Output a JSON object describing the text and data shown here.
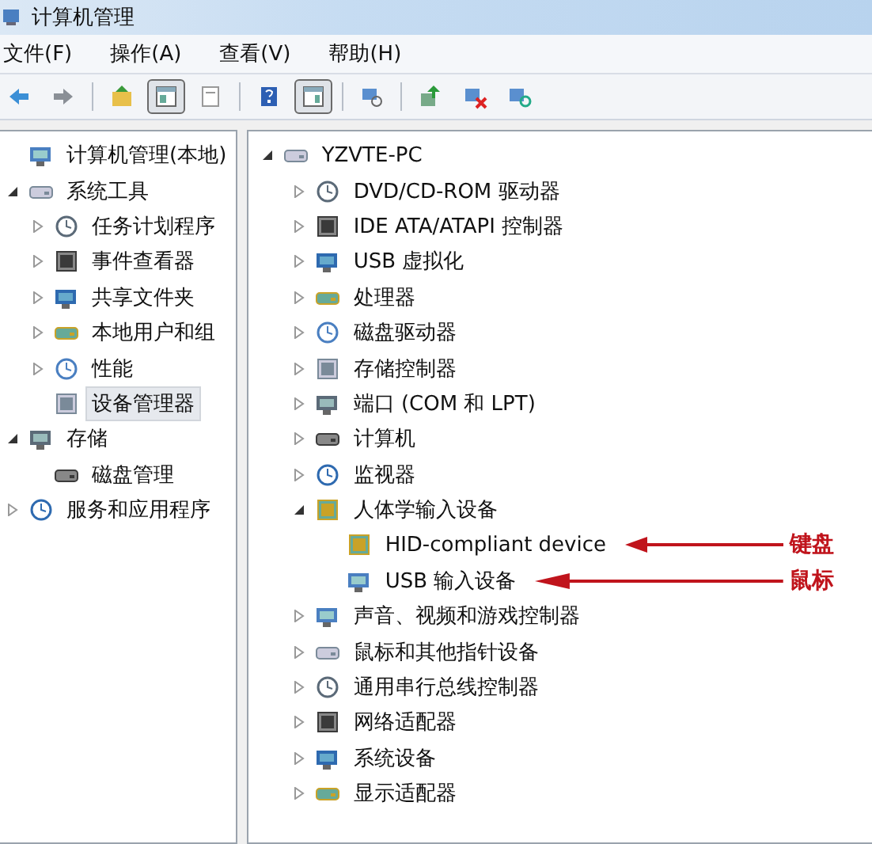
{
  "window": {
    "title": "计算机管理"
  },
  "menu": [
    "文件(F)",
    "操作(A)",
    "查看(V)",
    "帮助(H)"
  ],
  "toolbar": [
    {
      "selected": false
    },
    {
      "selected": false
    },
    {
      "selected": false
    },
    {
      "selected": true
    },
    {
      "selected": false
    },
    {
      "selected": false
    },
    {
      "selected": true
    },
    {
      "selected": false
    },
    {
      "selected": false
    },
    {
      "selected": false
    },
    {
      "selected": false
    }
  ],
  "left_tree": [
    {
      "label": "计算机管理(本地)",
      "selected": false,
      "children": [
        {
          "label": "系统工具",
          "expanded": true,
          "selected": false,
          "children": [
            {
              "label": "任务计划程序",
              "expanded": false,
              "selected": false
            },
            {
              "label": "事件查看器",
              "expanded": false,
              "selected": false
            },
            {
              "label": "共享文件夹",
              "expanded": false,
              "selected": false
            },
            {
              "label": "本地用户和组",
              "expanded": false,
              "selected": false
            },
            {
              "label": "性能",
              "expanded": false,
              "selected": false
            },
            {
              "label": "设备管理器",
              "selected": true
            }
          ]
        },
        {
          "label": "存储",
          "expanded": true,
          "selected": false,
          "children": [
            {
              "label": "磁盘管理",
              "selected": false
            }
          ]
        },
        {
          "label": "服务和应用程序",
          "expanded": false,
          "selected": false
        }
      ]
    }
  ],
  "device_tree": {
    "label": "YZVTE-PC",
    "expanded": true,
    "children": [
      {
        "label": "DVD/CD-ROM 驱动器",
        "expanded": false
      },
      {
        "label": "IDE ATA/ATAPI 控制器",
        "expanded": false
      },
      {
        "label": "USB 虚拟化",
        "expanded": false
      },
      {
        "label": "处理器",
        "expanded": false
      },
      {
        "label": "磁盘驱动器",
        "expanded": false
      },
      {
        "label": "存储控制器",
        "expanded": false
      },
      {
        "label": "端口 (COM 和 LPT)",
        "expanded": false
      },
      {
        "label": "计算机",
        "expanded": false
      },
      {
        "label": "监视器",
        "expanded": false
      },
      {
        "label": "人体学输入设备",
        "expanded": true,
        "children": [
          {
            "label": "HID-compliant device",
            "annotation": "键盘",
            "color": "#c0141c"
          },
          {
            "label": "USB 输入设备",
            "annotation": "鼠标",
            "color": "#c0141c"
          }
        ]
      },
      {
        "label": "声音、视频和游戏控制器",
        "expanded": false
      },
      {
        "label": "鼠标和其他指针设备",
        "expanded": false
      },
      {
        "label": "通用串行总线控制器",
        "expanded": false
      },
      {
        "label": "网络适配器",
        "expanded": false
      },
      {
        "label": "系统设备",
        "expanded": false
      },
      {
        "label": "显示适配器",
        "expanded": false
      }
    ]
  }
}
